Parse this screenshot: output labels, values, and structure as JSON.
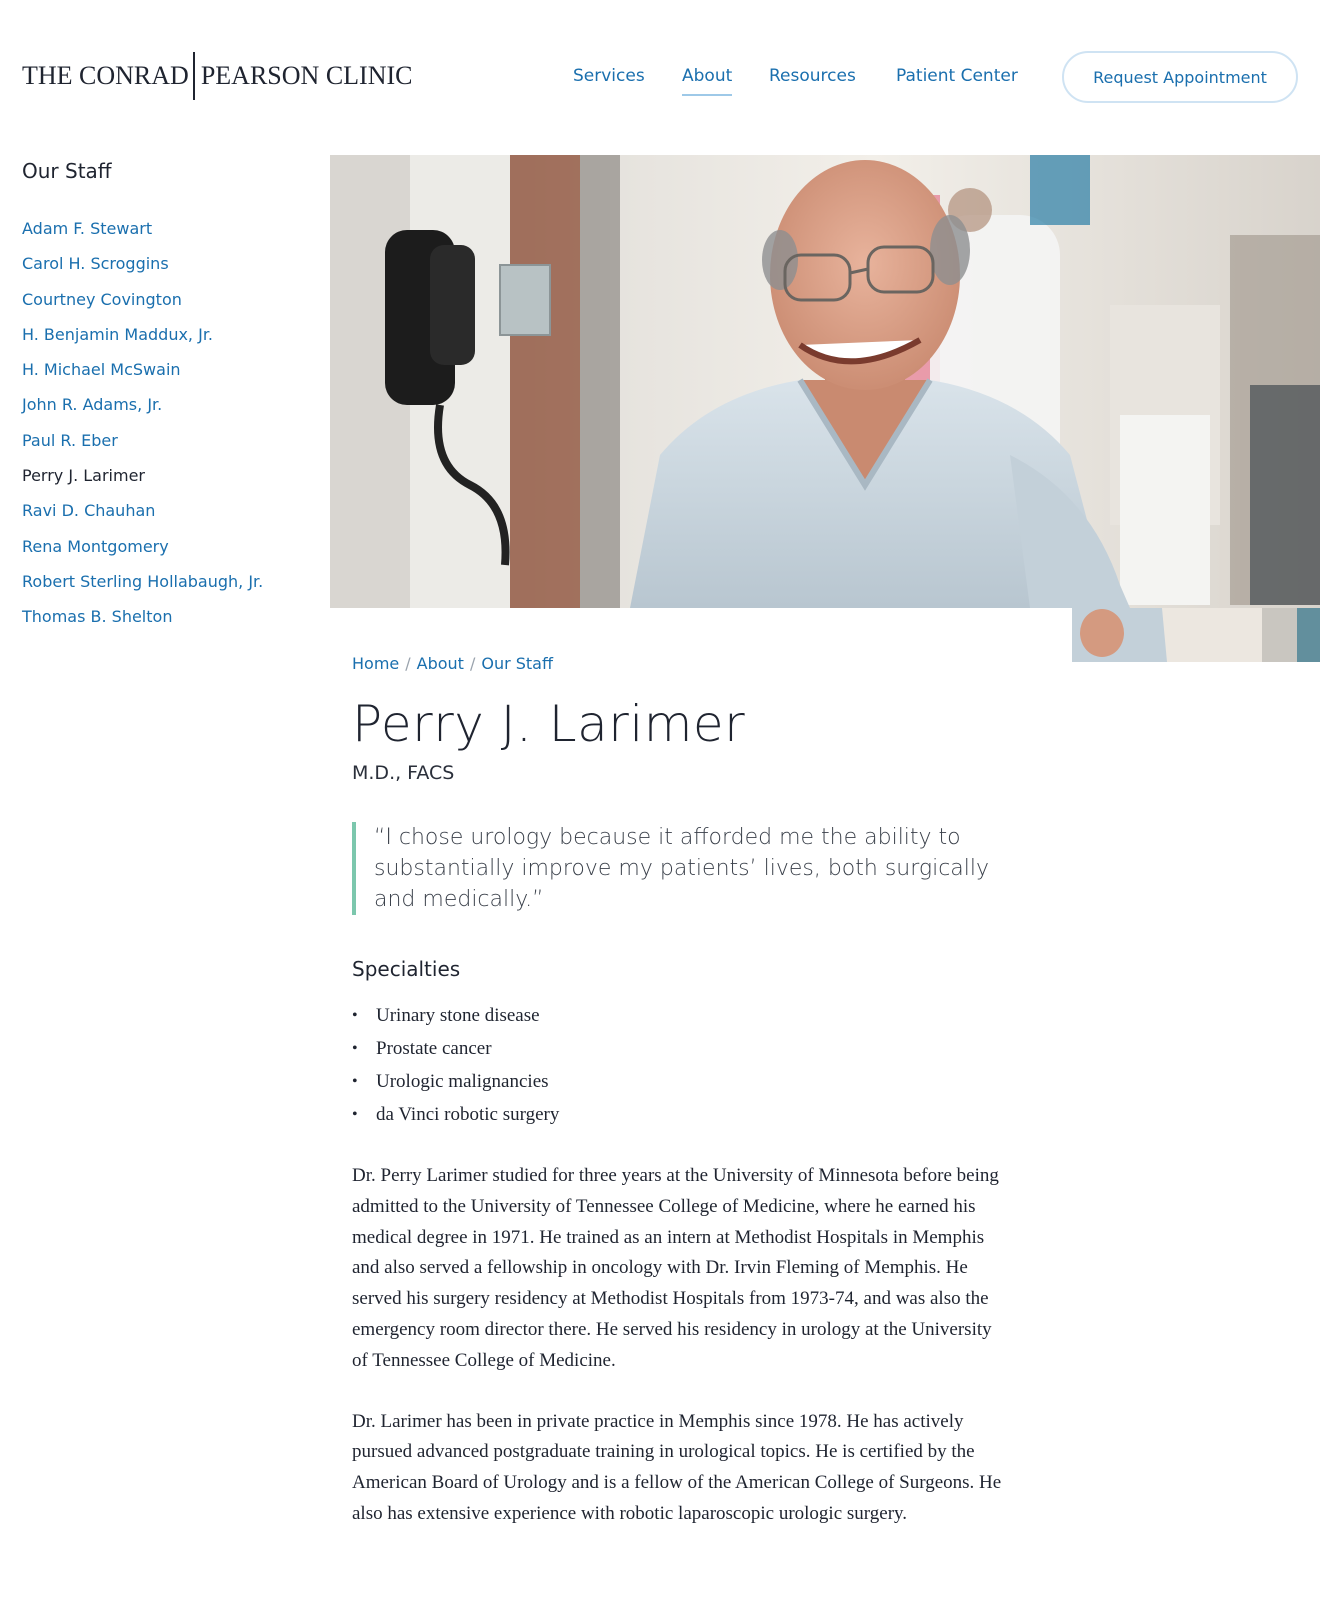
{
  "header": {
    "logo_left": "THE CONRAD",
    "logo_right": "PEARSON CLINIC",
    "nav": [
      {
        "label": "Services"
      },
      {
        "label": "About"
      },
      {
        "label": "Resources"
      },
      {
        "label": "Patient Center"
      }
    ],
    "active_nav": "About",
    "cta_label": "Request Appointment"
  },
  "sidebar": {
    "title": "Our Staff",
    "items": [
      "Adam F. Stewart",
      "Carol H. Scroggins",
      "Courtney Covington",
      "H. Benjamin Maddux, Jr.",
      "H. Michael McSwain",
      "John R. Adams, Jr.",
      "Paul R. Eber",
      "Perry J. Larimer",
      "Ravi D. Chauhan",
      "Rena Montgomery",
      "Robert Sterling Hollabaugh, Jr.",
      "Thomas B. Shelton"
    ],
    "current_item": "Perry J. Larimer"
  },
  "breadcrumb": [
    "Home",
    "About",
    "Our Staff"
  ],
  "profile": {
    "name": "Perry J. Larimer",
    "credentials": "M.D., FACS",
    "quote": "“I chose urology because it afforded me the ability to substantially improve my patients’ lives, both surgically and medically.”",
    "specialties_heading": "Specialties",
    "specialties": [
      "Urinary stone disease",
      "Prostate cancer",
      "Urologic malignancies",
      "da Vinci robotic surgery"
    ],
    "bio": [
      "Dr. Perry Larimer studied for three years at the University of Minnesota before being admitted to the University of Tennessee College of Medicine, where he earned his medical degree in 1971. He trained as an intern at Methodist Hospitals in Memphis and also served a fellowship in oncology with Dr. Irvin Fleming of Memphis. He served his surgery residency at Methodist Hospitals from 1973-74, and was also the emergency room director there. He served his residency in urology at the University of Tennessee College of Medicine.",
      "Dr. Larimer has been in private practice in Memphis since 1978. He has actively pursued advanced postgraduate training in urological topics. He is certified by the American Board of Urology and is a fellow of the American College of Surgeons. He also has extensive experience with robotic laparoscopic urologic surgery."
    ]
  },
  "colors": {
    "link": "#1a6fae",
    "text": "#1f2430",
    "quote_rule": "#7cc7ad",
    "cta_border": "#cfe3f3"
  }
}
